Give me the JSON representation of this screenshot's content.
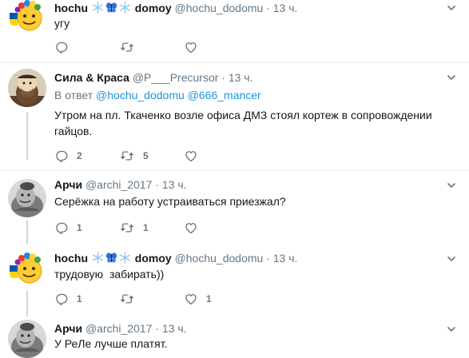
{
  "tweets": [
    {
      "name_a": "hochu",
      "name_b": "domoy",
      "handle": "@hochu_dodomu",
      "dot": "·",
      "time": "13 ч.",
      "text": "угу",
      "reply_count": "",
      "retweet_count": "",
      "like_count": ""
    },
    {
      "name": "Сила & Краса",
      "handle": "@P___Precursor",
      "dot": "·",
      "time": "13 ч.",
      "reply_prefix": "В ответ",
      "reply_mention_1": "@hochu_dodomu",
      "reply_mention_2": "@666_mancer",
      "text": "Утром на пл. Ткаченко возле офиса ДМЗ стоял кортеж в сопровождении гайцов.",
      "reply_count": "2",
      "retweet_count": "5",
      "like_count": ""
    },
    {
      "name": "Арчи",
      "handle": "@archi_2017",
      "dot": "·",
      "time": "13 ч.",
      "text": "Серёжка на работу устраиваться приезжал?",
      "reply_count": "1",
      "retweet_count": "1",
      "like_count": ""
    },
    {
      "name_a": "hochu",
      "name_b": "domoy",
      "handle": "@hochu_dodomu",
      "dot": "·",
      "time": "13 ч.",
      "text": "трудовую  забирать))",
      "reply_count": "1",
      "retweet_count": "",
      "like_count": "1"
    },
    {
      "name": "Арчи",
      "handle": "@archi_2017",
      "dot": "·",
      "time": "13 ч.",
      "text": "У РеЛе лучше платят."
    }
  ],
  "icons": {
    "reply": "reply-icon",
    "retweet": "retweet-icon",
    "like": "heart-icon",
    "more": "chevron-down-icon",
    "snowflake": "snowflake-emoji",
    "butterfly": "butterfly-emoji"
  },
  "colors": {
    "text": "#14171a",
    "muted": "#657786",
    "link": "#1b95e0",
    "thread_line": "#ccd6dd",
    "divider": "#e6ecf0"
  }
}
